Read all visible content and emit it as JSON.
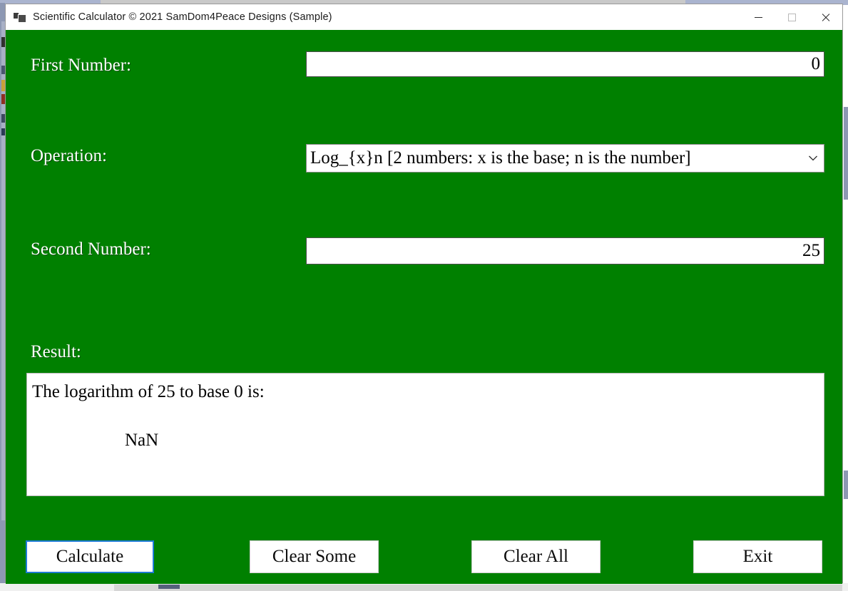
{
  "window": {
    "title": "Scientific Calculator © 2021 SamDom4Peace Designs (Sample)",
    "icon": "app-window-icon",
    "background_color": "#008000",
    "controls": {
      "minimize": "minimize-icon",
      "maximize": "maximize-icon",
      "close": "close-icon"
    }
  },
  "form": {
    "first_number": {
      "label": "First Number:",
      "value": "0",
      "placeholder": ""
    },
    "operation": {
      "label": "Operation:",
      "selected": "Log_{x}n [2 numbers: x is the base; n is the number]",
      "arrow_icon": "chevron-down-icon"
    },
    "second_number": {
      "label": "Second Number:",
      "value": "25",
      "placeholder": ""
    },
    "result": {
      "label": "Result:",
      "line1": "The logarithm of 25 to base 0 is:",
      "line2": "NaN"
    }
  },
  "buttons": {
    "calculate": "Calculate",
    "clear_some": "Clear Some",
    "clear_all": "Clear All",
    "exit": "Exit"
  }
}
